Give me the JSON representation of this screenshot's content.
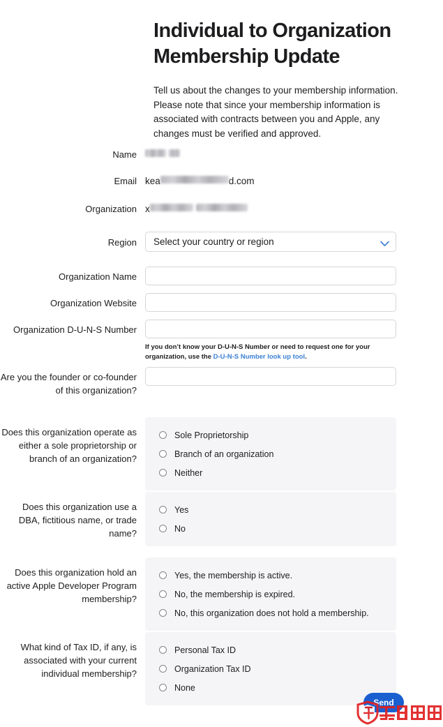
{
  "header": {
    "title": "Individual to Organization Membership Update",
    "description": "Tell us about the changes to your membership information. Please note that since your membership information is associated with contracts between you and Apple, any changes must be verified and approved."
  },
  "form": {
    "static_fields": [
      {
        "label": "Name",
        "value_visible": "",
        "value_suffix": "xp",
        "redacted": true
      },
      {
        "label": "Email",
        "value_visible": "kea",
        "value_suffix": "d.com",
        "redacted": true
      },
      {
        "label": "Organization",
        "value_visible": "x",
        "value_suffix": "",
        "redacted": true
      }
    ],
    "region": {
      "label": "Region",
      "selected": "Select your country or region",
      "chevron_color": "#3b7fd4"
    },
    "text_fields": [
      {
        "label": "Organization Name",
        "value": "",
        "placeholder": ""
      },
      {
        "label": "Organization Website",
        "value": "",
        "placeholder": ""
      },
      {
        "label": "Organization D-U-N-S Number",
        "value": "",
        "placeholder": ""
      }
    ],
    "duns_hint": {
      "text_before": "If you don’t know your D-U-N-S Number or need to request one for your organization, use the ",
      "link_text": "D-U-N-S Number look up tool",
      "text_after": "."
    },
    "founder_field": {
      "label": "Are you the founder or co-founder of this organization?",
      "value": "",
      "placeholder": ""
    },
    "radio_groups": [
      {
        "label": "Does this organization operate as either a sole proprietorship or branch of an organization?",
        "options": [
          "Sole Proprietorship",
          "Branch of an organization",
          "Neither"
        ],
        "selected": null
      },
      {
        "label": "Does this organization use a DBA, fictitious name, or trade name?",
        "options": [
          "Yes",
          "No"
        ],
        "selected": null
      },
      {
        "label": "Does this organization hold an active Apple Developer Program membership?",
        "options": [
          "Yes, the membership is active.",
          "No, the membership is expired.",
          "No, this organization does not hold a membership."
        ],
        "selected": null
      },
      {
        "label": "What kind of Tax ID, if any, is associated with your current individual membership?",
        "options": [
          "Personal Tax ID",
          "Organization Tax ID",
          "None"
        ],
        "selected": null
      }
    ]
  },
  "actions": {
    "send_label": "Send",
    "send_color": "#1a5fd0"
  },
  "watermark": {
    "text": "无锡雷霆",
    "color": "#e02020"
  }
}
